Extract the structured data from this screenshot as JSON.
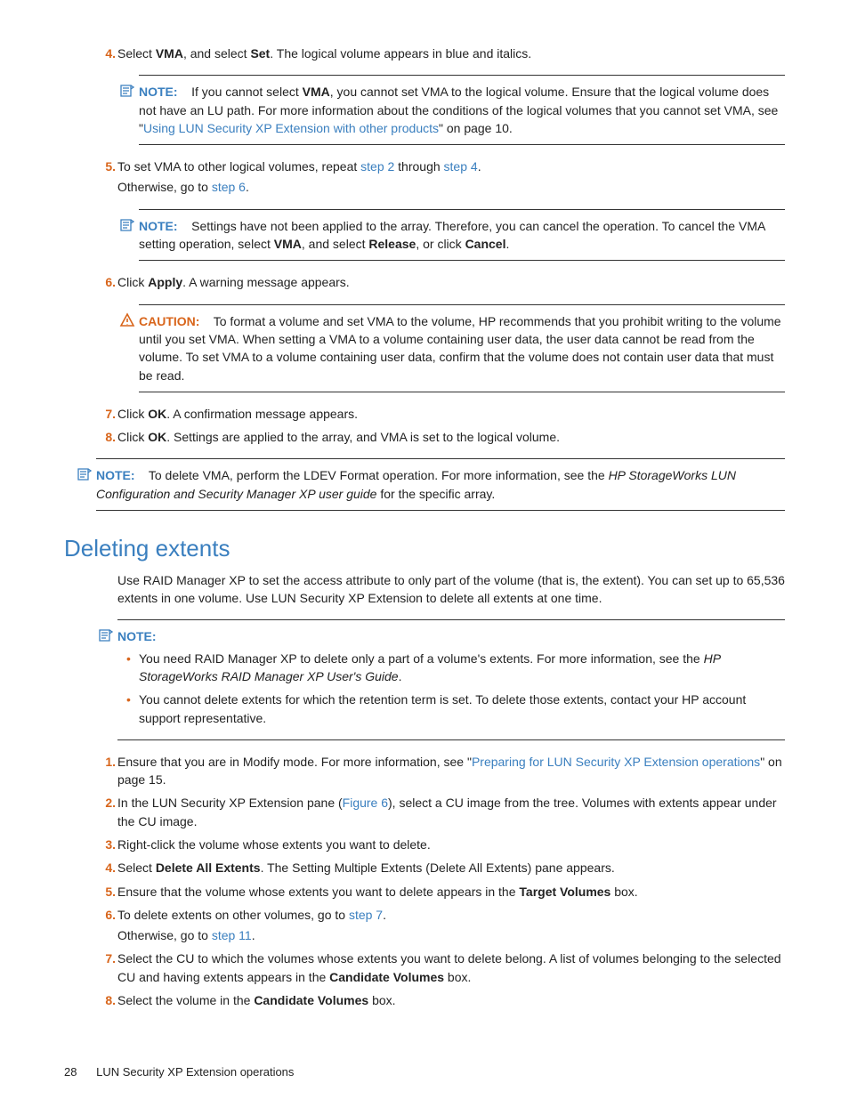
{
  "steps_a": {
    "s4": {
      "num": "4.",
      "pre": "Select ",
      "vma": "VMA",
      "mid": ", and select ",
      "set": "Set",
      "post": ". The logical volume appears in blue and italics."
    },
    "note4": {
      "label": "NOTE:",
      "t1": "If you cannot select ",
      "vma": "VMA",
      "t2": ", you cannot set VMA to the logical volume. Ensure that the logical volume does not have an LU path. For more information about the conditions of the logical volumes that you cannot set VMA, see \"",
      "link": "Using LUN Security XP Extension with other products",
      "t3": "\" on page 10."
    },
    "s5": {
      "num": "5.",
      "t1": "To set VMA to other logical volumes, repeat ",
      "l1": "step 2",
      "t2": " through ",
      "l2": "step 4",
      "t3": ".",
      "sub1": "Otherwise, go to ",
      "subl": "step 6",
      "sub2": "."
    },
    "note5": {
      "label": "NOTE:",
      "t1": "Settings have not been applied to the array. Therefore, you can cancel the operation. To cancel the VMA setting operation, select ",
      "vma": "VMA",
      "t2": ", and select ",
      "rel": "Release",
      "t3": ", or click ",
      "can": "Cancel",
      "t4": "."
    },
    "s6": {
      "num": "6.",
      "t1": "Click ",
      "apply": "Apply",
      "t2": ". A warning message appears."
    },
    "caution6": {
      "label": "CAUTION:",
      "text": "To format a volume and set VMA to the volume, HP recommends that you prohibit writing to the volume until you set VMA. When setting a VMA to a volume containing user data, the user data cannot be read from the volume. To set VMA to a volume containing user data, confirm that the volume does not contain user data that must be read."
    },
    "s7": {
      "num": "7.",
      "t1": "Click ",
      "ok": "OK",
      "t2": ". A confirmation message appears."
    },
    "s8": {
      "num": "8.",
      "t1": "Click ",
      "ok": "OK",
      "t2": ". Settings are applied to the array, and VMA is set to the logical volume."
    }
  },
  "outer_note": {
    "label": "NOTE:",
    "t1": "To delete VMA, perform the LDEV Format operation. For more information, see the ",
    "it": "HP StorageWorks LUN Configuration and Security Manager XP user guide",
    "t2": " for the specific array."
  },
  "section_title": "Deleting extents",
  "section_intro": "Use RAID Manager XP to set the access attribute to only part of the volume (that is, the extent). You can set up to 65,536 extents in one volume. Use LUN Security XP Extension to delete all extents at one time.",
  "del_note": {
    "label": "NOTE:",
    "b1a": "You need RAID Manager XP to delete only a part of a volume's extents. For more information, see the ",
    "b1it": "HP StorageWorks RAID Manager XP User's Guide",
    "b1b": ".",
    "b2": "You cannot delete extents for which the retention term is set. To delete those extents, contact your HP account support representative."
  },
  "steps_b": {
    "s1": {
      "num": "1.",
      "t1": "Ensure that you are in Modify mode. For more information, see \"",
      "l": "Preparing for LUN Security XP Extension operations",
      "t2": "\" on page 15."
    },
    "s2": {
      "num": "2.",
      "t1": "In the LUN Security XP Extension pane (",
      "l": "Figure 6",
      "t2": "), select a CU image from the tree. Volumes with extents appear under the CU image."
    },
    "s3": {
      "num": "3.",
      "text": "Right-click the volume whose extents you want to delete."
    },
    "s4": {
      "num": "4.",
      "t1": "Select ",
      "b": "Delete All Extents",
      "t2": ". The Setting Multiple Extents (Delete All Extents) pane appears."
    },
    "s5": {
      "num": "5.",
      "t1": "Ensure that the volume whose extents you want to delete appears in the ",
      "b": "Target Volumes",
      "t2": " box."
    },
    "s6": {
      "num": "6.",
      "t1": "To delete extents on other volumes, go to ",
      "l": "step 7",
      "t2": ".",
      "sub1": "Otherwise, go to ",
      "subl": "step 11",
      "sub2": "."
    },
    "s7": {
      "num": "7.",
      "t1": "Select the CU to which the volumes whose extents you want to delete belong. A list of volumes belonging to the selected CU and having extents appears in the ",
      "b": "Candidate Volumes",
      "t2": " box."
    },
    "s8": {
      "num": "8.",
      "t1": "Select the volume in the ",
      "b": "Candidate Volumes",
      "t2": " box."
    }
  },
  "footer": {
    "page": "28",
    "title": "LUN Security XP Extension operations"
  }
}
